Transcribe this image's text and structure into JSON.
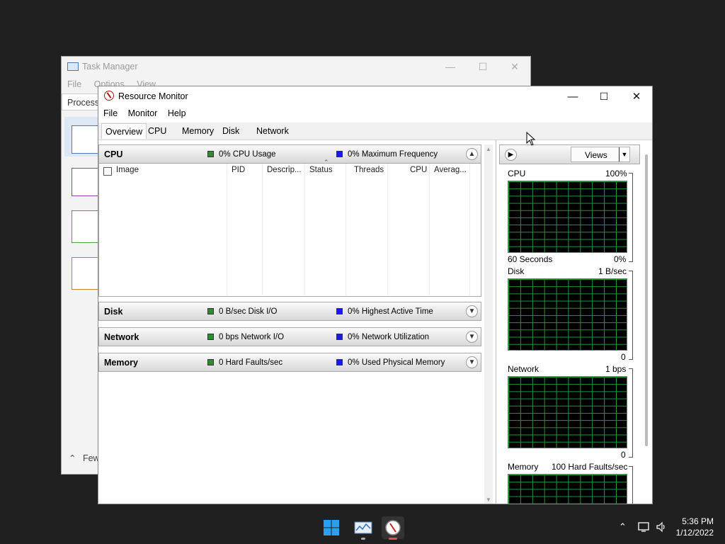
{
  "task_manager": {
    "title": "Task Manager",
    "menu": [
      "File",
      "Options",
      "View"
    ],
    "tab": "Processes",
    "footer": "Fewer details",
    "thumb_colors": [
      "#4a78c8",
      "#9b3db8",
      "#4aa33a",
      "#c8802a"
    ]
  },
  "resource_monitor": {
    "title": "Resource Monitor",
    "menu": {
      "file": "File",
      "monitor": "Monitor",
      "help": "Help"
    },
    "tabs": {
      "overview": "Overview",
      "cpu": "CPU",
      "memory": "Memory",
      "disk": "Disk",
      "network": "Network"
    },
    "sections": {
      "cpu": {
        "title": "CPU",
        "stat1": "0% CPU Usage",
        "stat2": "0% Maximum Frequency",
        "expanded": true
      },
      "disk": {
        "title": "Disk",
        "stat1": "0 B/sec Disk I/O",
        "stat2": "0% Highest Active Time"
      },
      "network": {
        "title": "Network",
        "stat1": "0 bps Network I/O",
        "stat2": "0% Network Utilization"
      },
      "memory": {
        "title": "Memory",
        "stat1": "0 Hard Faults/sec",
        "stat2": "0% Used Physical Memory"
      }
    },
    "cpu_table_columns": {
      "image": "Image",
      "pid": "PID",
      "description": "Descrip...",
      "status": "Status",
      "threads": "Threads",
      "cpu": "CPU",
      "average": "Averag..."
    },
    "views_label": "Views",
    "graphs": {
      "cpu": {
        "label": "CPU",
        "max": "100%",
        "time": "60 Seconds",
        "min": "0%"
      },
      "disk": {
        "label": "Disk",
        "max": "1 B/sec",
        "min": "0"
      },
      "network": {
        "label": "Network",
        "max": "1 bps",
        "min": "0"
      },
      "memory": {
        "label": "Memory",
        "max": "100 Hard Faults/sec"
      }
    }
  },
  "taskbar": {
    "time": "5:36 PM",
    "date": "1/12/2022"
  },
  "colors": {
    "graph_grid": "#1f9a3a",
    "legend_green": "#2e8b2e",
    "legend_blue": "#1a1ae0",
    "desktop": "#202020"
  }
}
